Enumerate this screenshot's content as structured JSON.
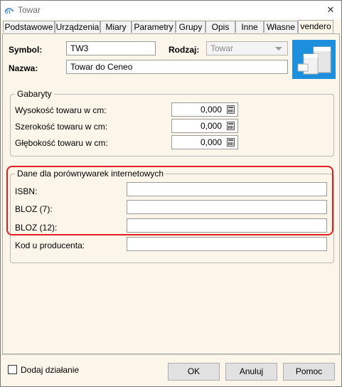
{
  "window": {
    "title": "Towar",
    "close_symbol": "✕"
  },
  "tabs": [
    {
      "label": "Podstawowe"
    },
    {
      "label": "Urządzenia"
    },
    {
      "label": "Miary"
    },
    {
      "label": "Parametry"
    },
    {
      "label": "Grupy"
    },
    {
      "label": "Opis"
    },
    {
      "label": "Inne"
    },
    {
      "label": "Własne"
    },
    {
      "label": "vendero",
      "active": true
    }
  ],
  "header": {
    "symbol_label": "Symbol:",
    "symbol_value": "TW3",
    "rodzaj_label": "Rodzaj:",
    "rodzaj_value": "Towar",
    "nazwa_label": "Nazwa:",
    "nazwa_value": "Towar do Ceneo"
  },
  "gabaryty": {
    "legend": "Gabaryty",
    "rows": [
      {
        "label": "Wysokość towaru w cm:",
        "value": "0,000"
      },
      {
        "label": "Szerokość towaru w cm:",
        "value": "0,000"
      },
      {
        "label": "Głębokość towaru w cm:",
        "value": "0,000"
      }
    ]
  },
  "porownywarki": {
    "legend": "Dane dla porównywarek internetowych",
    "rows": [
      {
        "label": "ISBN:",
        "value": ""
      },
      {
        "label": "BLOZ (7):",
        "value": ""
      },
      {
        "label": "BLOZ (12):",
        "value": ""
      },
      {
        "label": "Kod u producenta:",
        "value": ""
      }
    ],
    "highlight_color": "#e02020"
  },
  "footer": {
    "checkbox_label": "Dodaj działanie",
    "checkbox_checked": false,
    "ok_label": "OK",
    "cancel_label": "Anuluj",
    "help_label": "Pomoc"
  },
  "colors": {
    "panel_bg": "#fbf5ea",
    "logo_bg": "#1d8fdc"
  }
}
